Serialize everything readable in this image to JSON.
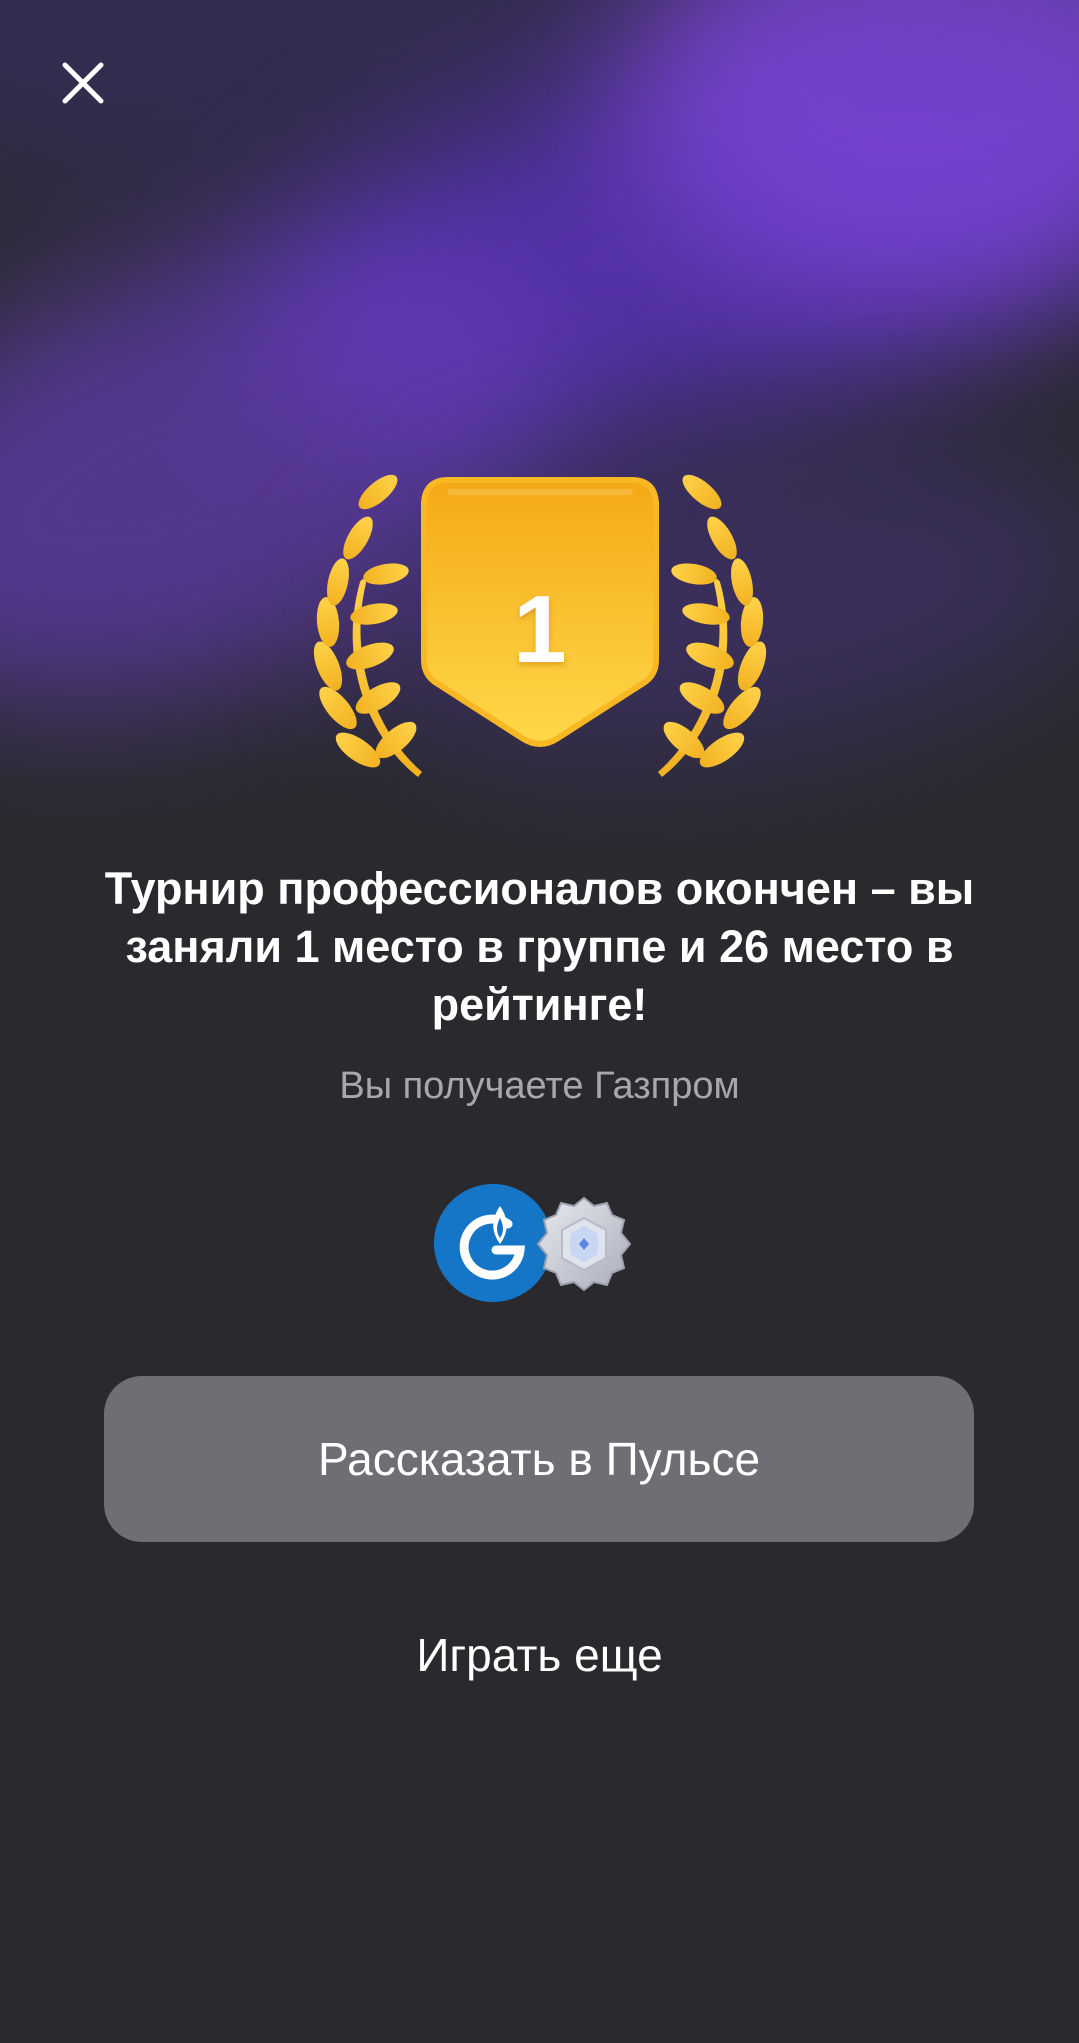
{
  "header": {
    "close_icon": "close-icon"
  },
  "award": {
    "place_number": "1",
    "icon": "laurel-medal-icon",
    "colors": {
      "medal_top": "#f4a916",
      "medal_bottom": "#ffd84a",
      "laurel": "#f6c43a"
    }
  },
  "result": {
    "headline": "Турнир профессионалов окончен – вы заняли 1 место в группе и 26 место в рейтинге!",
    "subtitle": "Вы получаете Газпром"
  },
  "rewards": {
    "items": [
      {
        "icon": "gazprom-logo-icon",
        "color": "#1576c8"
      },
      {
        "icon": "silver-badge-icon",
        "color": "#c5c8d2"
      }
    ]
  },
  "actions": {
    "share_label": "Рассказать в Пульсе",
    "play_again_label": "Играть еще"
  },
  "theme": {
    "background": "#2a2a2e",
    "accent_purple": "#6a3fc4",
    "button_bg": "#6e6e74",
    "subtitle_color": "#a7a7ac"
  }
}
